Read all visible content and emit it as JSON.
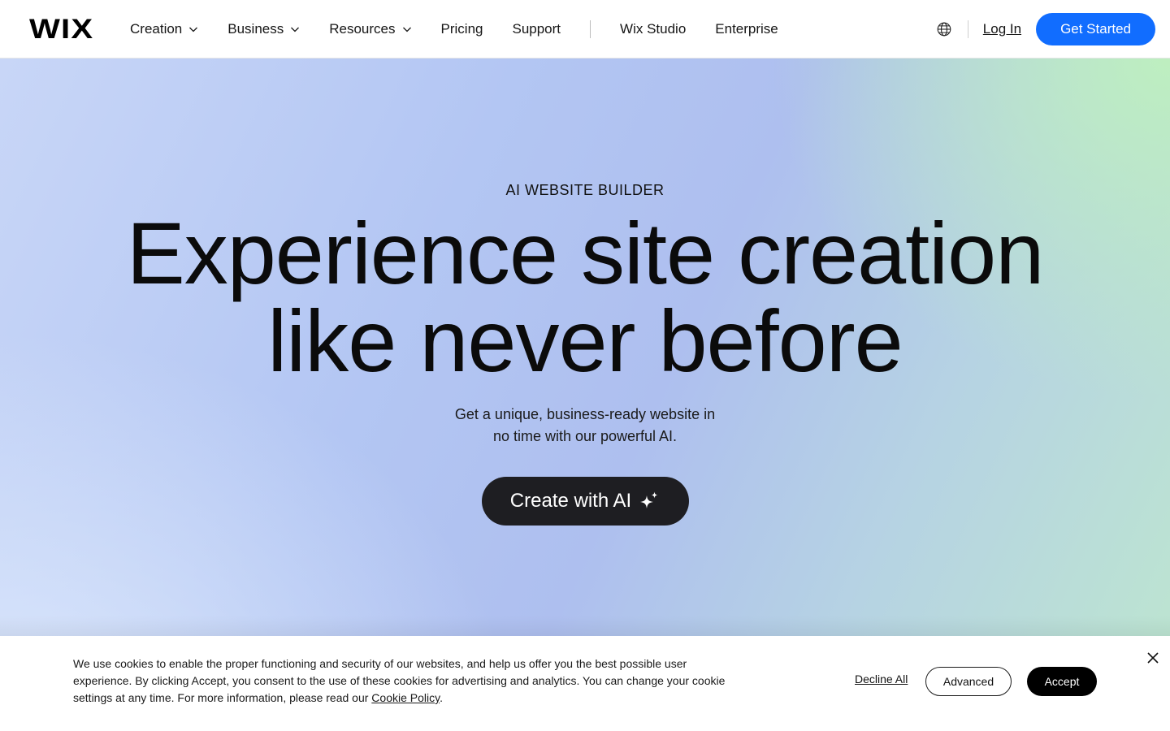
{
  "header": {
    "logo": "WIX",
    "nav": [
      {
        "label": "Creation",
        "has_dropdown": true
      },
      {
        "label": "Business",
        "has_dropdown": true
      },
      {
        "label": "Resources",
        "has_dropdown": true
      },
      {
        "label": "Pricing",
        "has_dropdown": false
      },
      {
        "label": "Support",
        "has_dropdown": false
      }
    ],
    "nav_secondary": [
      {
        "label": "Wix Studio"
      },
      {
        "label": "Enterprise"
      }
    ],
    "language_icon": "globe-icon",
    "login_label": "Log In",
    "get_started_label": "Get Started"
  },
  "hero": {
    "eyebrow": "AI WEBSITE BUILDER",
    "headline_line1": "Experience site creation",
    "headline_line2": "like never before",
    "subtext_line1": "Get a unique, business-ready website in",
    "subtext_line2": "no time with our powerful AI.",
    "cta_label": "Create with AI",
    "cta_icon": "sparkle-icon"
  },
  "cookie_banner": {
    "text_line1": "We use cookies to enable the proper functioning and security of our websites, and help us offer you the best possible user",
    "text_line2": "experience. By clicking Accept, you consent to the use of these cookies for advertising and analytics. You can change your cookie",
    "text_line3": "settings at any time. For more information, please read our",
    "policy_link": "Cookie Policy",
    "period": ".",
    "decline_label": "Decline All",
    "advanced_label": "Advanced",
    "accept_label": "Accept",
    "close_icon": "close-icon"
  },
  "colors": {
    "accent": "#116dff",
    "cta_dark": "#1e1e22",
    "text": "#0a0a0a"
  }
}
